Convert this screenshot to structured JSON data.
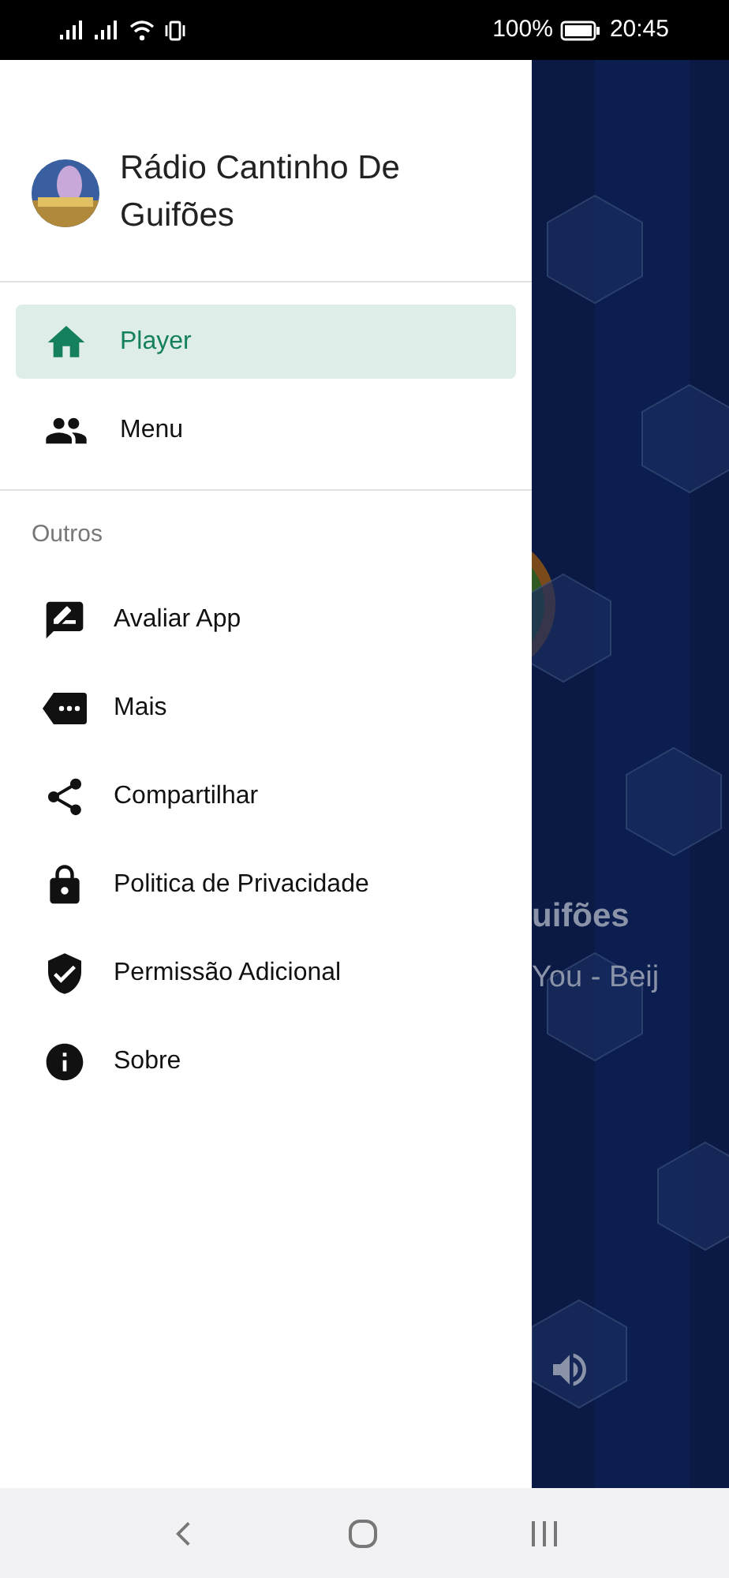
{
  "status_bar": {
    "battery": "100%",
    "time": "20:45"
  },
  "drawer": {
    "title": "Rádio Cantinho De Guifões",
    "main_items": [
      {
        "label": "Player",
        "selected": true
      },
      {
        "label": "Menu",
        "selected": false
      }
    ],
    "section_title": "Outros",
    "other_items": [
      {
        "label": "Avaliar App"
      },
      {
        "label": "Mais"
      },
      {
        "label": "Compartilhar"
      },
      {
        "label": "Politica de Privacidade"
      },
      {
        "label": "Permissão Adicional"
      },
      {
        "label": "Sobre"
      }
    ]
  },
  "player_behind": {
    "station": "uifões",
    "track": "You - Beij"
  }
}
